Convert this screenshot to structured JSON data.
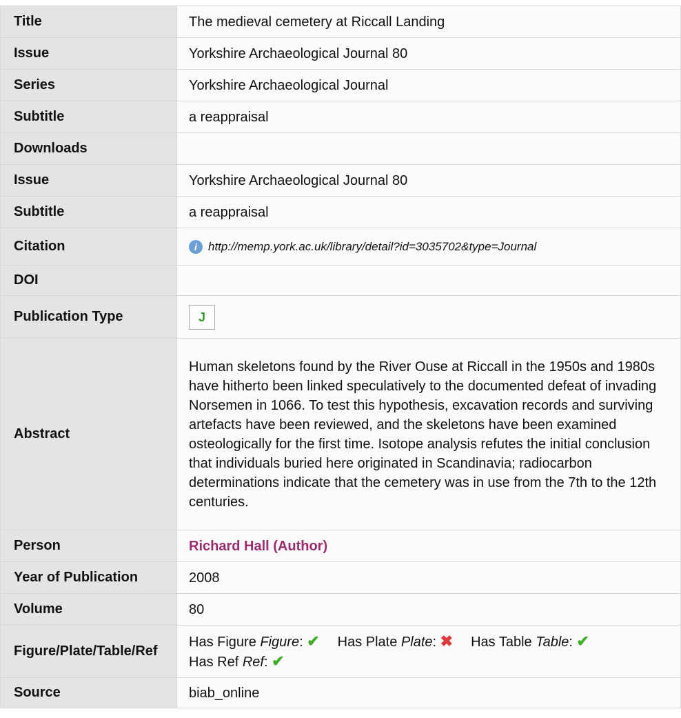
{
  "record": {
    "title": {
      "label": "Title",
      "value": "The medieval cemetery at Riccall Landing"
    },
    "issue": {
      "label": "Issue",
      "value": "Yorkshire Archaeological Journal 80"
    },
    "series": {
      "label": "Series",
      "value": "Yorkshire Archaeological Journal"
    },
    "subtitle": {
      "label": "Subtitle",
      "value": "a reappraisal"
    },
    "downloads": {
      "label": "Downloads",
      "value": ""
    },
    "issue2": {
      "label": "Issue",
      "value": "Yorkshire Archaeological Journal 80"
    },
    "subtitle2": {
      "label": "Subtitle",
      "value": "a reappraisal"
    },
    "citation": {
      "label": "Citation",
      "value": "http://memp.york.ac.uk/library/detail?id=3035702&type=Journal",
      "icon": "info-icon"
    },
    "doi": {
      "label": "DOI",
      "value": ""
    },
    "publication_type": {
      "label": "Publication Type",
      "value": "J"
    },
    "abstract": {
      "label": "Abstract",
      "value": "Human skeletons found by the River Ouse at Riccall in the 1950s and 1980s have hitherto been linked speculatively to the documented defeat of invading Norsemen in 1066. To test this hypothesis, excavation records and surviving artefacts have been reviewed, and the skeletons have been examined osteologically for the first time. Isotope analysis refutes the initial conclusion that individuals buried here originated in Scandinavia; radiocarbon determinations indicate that the cemetery was in use from the 7th to the 12th centuries."
    },
    "person": {
      "label": "Person",
      "value": "Richard Hall (Author)"
    },
    "year": {
      "label": "Year of Publication",
      "value": "2008"
    },
    "volume": {
      "label": "Volume",
      "value": "80"
    },
    "figures": {
      "label": "Figure/Plate/Table/Ref",
      "items": [
        {
          "prefix": "Has Figure ",
          "term": "Figure",
          "colon": ":",
          "has": true,
          "icon": "check-icon"
        },
        {
          "prefix": "Has Plate ",
          "term": "Plate",
          "colon": ":",
          "has": false,
          "icon": "cross-icon"
        },
        {
          "prefix": "Has Table ",
          "term": "Table",
          "colon": ":",
          "has": true,
          "icon": "check-icon"
        },
        {
          "prefix": "Has Ref ",
          "term": "Ref",
          "colon": ":",
          "has": true,
          "icon": "check-icon"
        }
      ]
    },
    "source": {
      "label": "Source",
      "value": "biab_online"
    }
  },
  "colors": {
    "label_bg": "#e4e4e4",
    "value_bg": "#fbfbfb",
    "border": "#d8d8d8",
    "person_link": "#9b2c6d",
    "check": "#3fae2a",
    "cross": "#e6373f",
    "pubtype_text": "#2e9a31",
    "info_icon": "#6f9fd8"
  }
}
